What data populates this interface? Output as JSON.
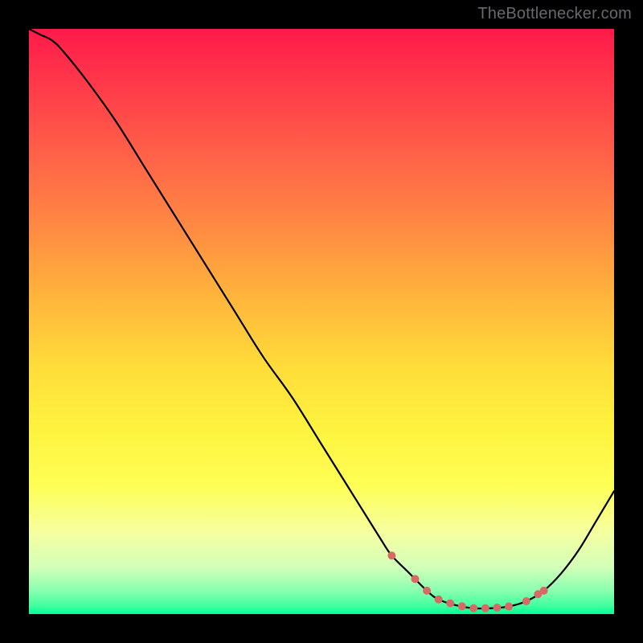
{
  "watermark": {
    "text": "TheBottlenecker.com"
  },
  "chart_data": {
    "type": "line",
    "title": "",
    "xlabel": "",
    "ylabel": "",
    "xlim": [
      0,
      100
    ],
    "ylim": [
      0,
      100
    ],
    "grid": false,
    "legend": false,
    "series": [
      {
        "name": "bottleneck-curve",
        "color": "#000000",
        "x": [
          0,
          2,
          4,
          6,
          10,
          15,
          20,
          25,
          30,
          35,
          40,
          45,
          50,
          55,
          60,
          62,
          65,
          68,
          70,
          73,
          76,
          79,
          82,
          85,
          88,
          91,
          94,
          97,
          100
        ],
        "values": [
          100,
          99,
          98,
          96,
          91,
          84,
          76,
          68,
          60,
          52,
          44,
          37,
          29,
          21,
          13,
          10,
          7,
          4,
          2.5,
          1.5,
          1,
          1,
          1.3,
          2.2,
          4,
          7,
          11,
          16,
          21
        ]
      }
    ],
    "optimal_markers": {
      "color": "#d86a66",
      "x": [
        62,
        66,
        68,
        70,
        72,
        74,
        76,
        78,
        80,
        82,
        85,
        87,
        88
      ]
    },
    "background_gradient": {
      "type": "vertical",
      "stops": [
        {
          "pos": 0,
          "color": "#ff1a49"
        },
        {
          "pos": 0.34,
          "color": "#ff8a42"
        },
        {
          "pos": 0.68,
          "color": "#fef23e"
        },
        {
          "pos": 0.92,
          "color": "#d3ffb9"
        },
        {
          "pos": 1.0,
          "color": "#00ff95"
        }
      ]
    }
  }
}
